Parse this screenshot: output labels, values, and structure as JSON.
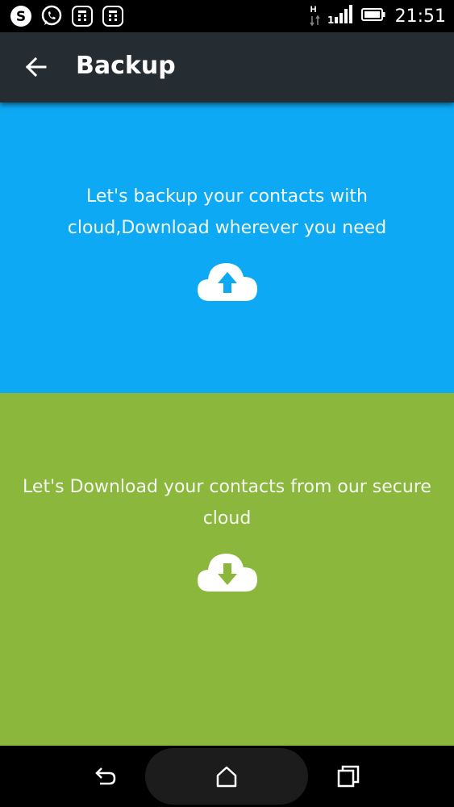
{
  "status_bar": {
    "app_icons": [
      "skype-icon",
      "whatsapp-icon",
      "calculator-icon",
      "calculator-icon"
    ],
    "network_type": "H",
    "time": "21:51"
  },
  "app_bar": {
    "title": "Backup"
  },
  "backup_panel": {
    "text": "Let's backup your contacts with cloud,Download wherever you need",
    "icon": "cloud-upload-icon",
    "color": "#0da9f5"
  },
  "download_panel": {
    "text": "Let's Download your contacts from our secure cloud",
    "icon": "cloud-download-icon",
    "color": "#8bb73c"
  },
  "nav_bar": {
    "buttons": [
      "back-icon",
      "home-icon",
      "recents-icon"
    ]
  }
}
